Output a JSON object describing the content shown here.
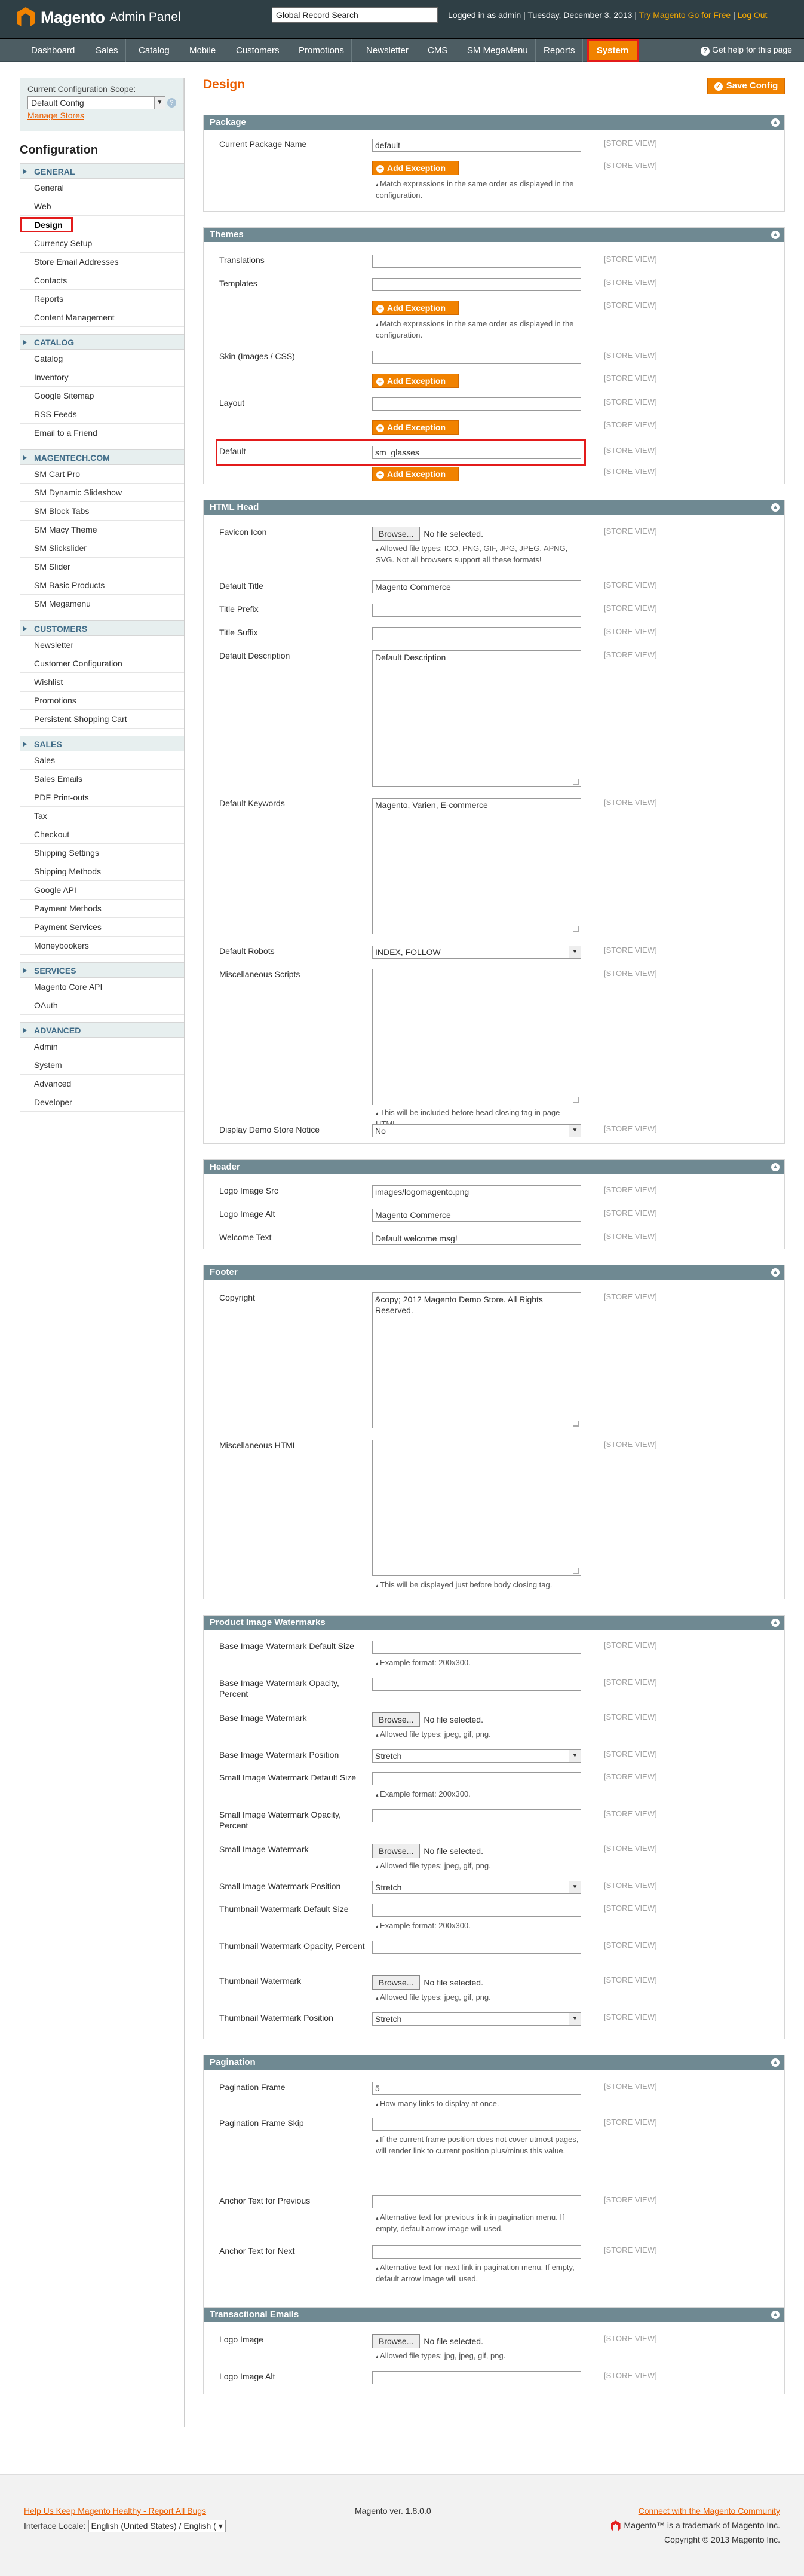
{
  "header": {
    "logo_main": "Magento",
    "logo_sub": "Admin Panel",
    "search_value": "Global Record Search",
    "logged_in": "Logged in as admin",
    "date": "Tuesday, December 3, 2013",
    "try_link": "Try Magento Go for Free",
    "logout": "Log Out"
  },
  "nav": {
    "items": [
      "Dashboard",
      "Sales",
      "Catalog",
      "Mobile",
      "Customers",
      "Promotions",
      "Newsletter",
      "CMS",
      "SM MegaMenu",
      "Reports",
      "System"
    ],
    "help": "Get help for this page"
  },
  "sidebar": {
    "scope_label": "Current Configuration Scope:",
    "scope_value": "Default Config",
    "manage_stores": "Manage Stores",
    "title": "Configuration",
    "groups": [
      {
        "name": "GENERAL",
        "items": [
          "General",
          "Web",
          "Design",
          "Currency Setup",
          "Store Email Addresses",
          "Contacts",
          "Reports",
          "Content Management"
        ]
      },
      {
        "name": "CATALOG",
        "items": [
          "Catalog",
          "Inventory",
          "Google Sitemap",
          "RSS Feeds",
          "Email to a Friend"
        ]
      },
      {
        "name": "MAGENTECH.COM",
        "items": [
          "SM Cart Pro",
          "SM Dynamic Slideshow",
          "SM Block Tabs",
          "SM Macy Theme",
          "SM Slickslider",
          "SM Slider",
          "SM Basic Products",
          "SM Megamenu"
        ]
      },
      {
        "name": "CUSTOMERS",
        "items": [
          "Newsletter",
          "Customer Configuration",
          "Wishlist",
          "Promotions",
          "Persistent Shopping Cart"
        ]
      },
      {
        "name": "SALES",
        "items": [
          "Sales",
          "Sales Emails",
          "PDF Print-outs",
          "Tax",
          "Checkout",
          "Shipping Settings",
          "Shipping Methods",
          "Google API",
          "Payment Methods",
          "Payment Services",
          "Moneybookers"
        ]
      },
      {
        "name": "SERVICES",
        "items": [
          "Magento Core API",
          "OAuth"
        ]
      },
      {
        "name": "ADVANCED",
        "items": [
          "Admin",
          "System",
          "Advanced",
          "Developer"
        ]
      }
    ]
  },
  "page": {
    "title": "Design",
    "save": "Save Config",
    "scope": "[STORE VIEW]",
    "add_exception": "Add Exception",
    "browse": "Browse...",
    "no_file": "No file selected."
  },
  "package": {
    "title": "Package",
    "label": "Current Package Name",
    "value": "default",
    "note": "Match expressions in the same order as displayed in the configuration."
  },
  "themes": {
    "title": "Themes",
    "translations": "Translations",
    "templates": "Templates",
    "templates_note": "Match expressions in the same order as displayed in the configuration.",
    "skin": "Skin (Images / CSS)",
    "layout": "Layout",
    "default": "Default",
    "default_value": "sm_glasses"
  },
  "head": {
    "title": "HTML Head",
    "favicon": "Favicon Icon",
    "favicon_note": "Allowed file types: ICO, PNG, GIF, JPG, JPEG, APNG, SVG. Not all browsers support all these formats!",
    "dtitle": "Default Title",
    "dtitle_value": "Magento Commerce",
    "prefix": "Title Prefix",
    "suffix": "Title Suffix",
    "ddesc": "Default Description",
    "ddesc_value": "Default Description",
    "dkey": "Default Keywords",
    "dkey_value": "Magento, Varien, E-commerce",
    "robots": "Default Robots",
    "robots_value": "INDEX, FOLLOW",
    "misc": "Miscellaneous Scripts",
    "misc_note": "This will be included before head closing tag in page HTML.",
    "demo": "Display Demo Store Notice",
    "demo_value": "No"
  },
  "hdr": {
    "title": "Header",
    "src": "Logo Image Src",
    "src_value": "images/logomagento.png",
    "alt": "Logo Image Alt",
    "alt_value": "Magento Commerce",
    "welcome": "Welcome Text",
    "welcome_value": "Default welcome msg!"
  },
  "foot": {
    "title": "Footer",
    "copy": "Copyright",
    "copy_value": "&copy; 2012 Magento Demo Store. All Rights Reserved.",
    "misc": "Miscellaneous HTML",
    "misc_note": "This will be displayed just before body closing tag."
  },
  "wm": {
    "title": "Product Image Watermarks",
    "base_size": "Base Image Watermark Default Size",
    "example": "Example format: 200x300.",
    "base_op": "Base Image Watermark Opacity, Percent",
    "base_wm": "Base Image Watermark",
    "types": "Allowed file types: jpeg, gif, png.",
    "base_pos": "Base Image Watermark Position",
    "stretch": "Stretch",
    "small_size": "Small Image Watermark Default Size",
    "small_op": "Small Image Watermark Opacity, Percent",
    "small_wm": "Small Image Watermark",
    "small_pos": "Small Image Watermark Position",
    "thumb_size": "Thumbnail Watermark Default Size",
    "thumb_op": "Thumbnail Watermark Opacity, Percent",
    "thumb_wm": "Thumbnail Watermark",
    "thumb_pos": "Thumbnail Watermark Position"
  },
  "pag": {
    "title": "Pagination",
    "frame": "Pagination Frame",
    "frame_value": "5",
    "frame_note": "How many links to display at once.",
    "skip": "Pagination Frame Skip",
    "skip_note": "If the current frame position does not cover utmost pages, will render link to current position plus/minus this value.",
    "prev": "Anchor Text for Previous",
    "prev_note": "Alternative text for previous link in pagination menu. If empty, default arrow image will used.",
    "next": "Anchor Text for Next",
    "next_note": "Alternative text for next link in pagination menu. If empty, default arrow image will used."
  },
  "te": {
    "title": "Transactional Emails",
    "logo": "Logo Image",
    "types": "Allowed file types: jpg, jpeg, gif, png.",
    "alt": "Logo Image Alt"
  },
  "footer": {
    "help": "Help Us Keep Magento Healthy - Report All Bugs",
    "locale_label": "Interface Locale:",
    "locale_value": "English (United States) / English (",
    "version": "Magento ver. 1.8.0.0",
    "connect": "Connect with the Magento Community",
    "trademark": "Magento™ is a trademark of Magento Inc.",
    "copyright": "Copyright © 2013 Magento Inc."
  }
}
